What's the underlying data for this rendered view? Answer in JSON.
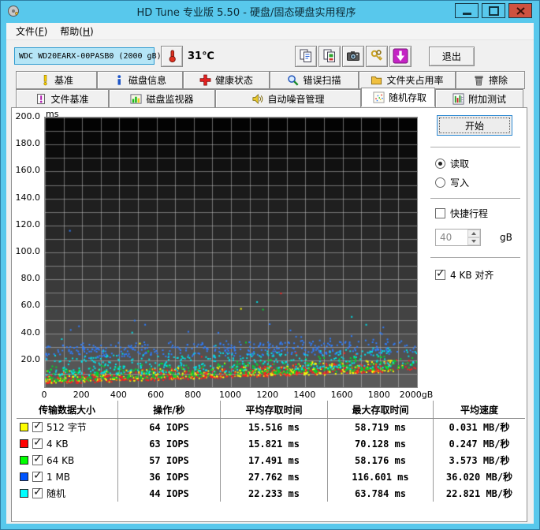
{
  "window": {
    "title": "HD Tune 专业版 5.50 - 硬盘/固态硬盘实用程序"
  },
  "menu": {
    "items": [
      {
        "pre": "文件(",
        "key": "F",
        "post": ")"
      },
      {
        "pre": "帮助(",
        "key": "H",
        "post": ")"
      }
    ]
  },
  "toolbar": {
    "drive_select": {
      "value": "WDC WD20EARX-00PASB0 (2000 gB)"
    },
    "temperature": "31℃",
    "icons": [
      "thermometer-icon",
      "copy-report-icon",
      "copy-image-icon",
      "camera-icon",
      "keys-icon",
      "update-icon"
    ],
    "exit_label": "退出"
  },
  "tabs": {
    "active": "随机存取",
    "row1": [
      {
        "label": "基准",
        "icon": "benchmark-icon"
      },
      {
        "label": "磁盘信息",
        "icon": "disk-info-icon"
      },
      {
        "label": "健康状态",
        "icon": "health-icon"
      },
      {
        "label": "错误扫描",
        "icon": "error-scan-icon"
      },
      {
        "label": "文件夹占用率",
        "icon": "folder-usage-icon"
      },
      {
        "label": "擦除",
        "icon": "erase-icon"
      }
    ],
    "row2": [
      {
        "label": "文件基准",
        "icon": "file-benchmark-icon"
      },
      {
        "label": "磁盘监视器",
        "icon": "disk-monitor-icon"
      },
      {
        "label": "自动噪音管理",
        "icon": "aam-icon"
      },
      {
        "label": "随机存取",
        "icon": "random-access-icon"
      },
      {
        "label": "附加测试",
        "icon": "extra-tests-icon"
      }
    ]
  },
  "controls": {
    "start_label": "开始",
    "read_label": "读取",
    "write_label": "写入",
    "read_selected": true,
    "write_selected": false,
    "short_stroke_label": "快捷行程",
    "short_stroke_checked": false,
    "short_stroke_value": "40",
    "short_stroke_unit": "gB",
    "align_label": "4 KB 对齐",
    "align_checked": true
  },
  "chart_data": {
    "type": "scatter",
    "title": "随机存取测试 (random access: access time vs disk position)",
    "ylabel_unit": "ms",
    "xlabel_unit": "gB",
    "xlim": [
      0,
      2000
    ],
    "ylim": [
      0,
      200
    ],
    "xticks": [
      0,
      200,
      400,
      600,
      800,
      1000,
      1200,
      1400,
      1600,
      1800,
      2000
    ],
    "xtick_last_label": "2000gB",
    "yticks": [
      20,
      40,
      60,
      80,
      100,
      120,
      140,
      160,
      180,
      200
    ],
    "x_grid_step": 100,
    "y_grid_step": 10,
    "grid_color": "rgba(200,200,200,0.5)",
    "background_gradient": [
      "#030303",
      "#5a5a5a"
    ],
    "series": [
      {
        "name": "512 字节",
        "color": "#ffff00",
        "approx_points": 420,
        "min_ms_at_0": 4.0,
        "min_ms_at_2000": 13.0,
        "band_ms": 8,
        "dist_pow": 2.2,
        "outlier_rate": 0.012,
        "outlier_max_ms": 46,
        "observed_avg_ms": 15.516,
        "observed_max_ms": 58.719
      },
      {
        "name": "4 KB",
        "color": "#ff2020",
        "approx_points": 420,
        "min_ms_at_0": 3.2,
        "min_ms_at_2000": 13.5,
        "band_ms": 8,
        "dist_pow": 2.2,
        "outlier_rate": 0.008,
        "outlier_max_ms": 52,
        "observed_avg_ms": 15.821,
        "observed_max_ms": 70.128
      },
      {
        "name": "64 KB",
        "color": "#00d830",
        "approx_points": 400,
        "min_ms_at_0": 5.0,
        "min_ms_at_2000": 15.0,
        "band_ms": 10,
        "dist_pow": 2.0,
        "outlier_rate": 0.015,
        "outlier_max_ms": 56,
        "observed_avg_ms": 17.491,
        "observed_max_ms": 58.176
      },
      {
        "name": "1 MB",
        "color": "#2e7dff",
        "approx_points": 380,
        "min_ms_at_0": 22.0,
        "min_ms_at_2000": 26.0,
        "band_ms": 10,
        "dist_pow": 1.0,
        "outlier_rate": 0.05,
        "outlier_max_ms": 58,
        "observed_avg_ms": 27.762,
        "observed_max_ms": 116.601,
        "outlier_point": {
          "x_gb": 130,
          "y_ms": 116.6
        }
      },
      {
        "name": "随机",
        "color": "#00e0e8",
        "approx_points": 400,
        "min_ms_at_0": 9.0,
        "min_ms_at_2000": 16.0,
        "band_ms": 14,
        "dist_pow": 1.5,
        "outlier_rate": 0.02,
        "outlier_max_ms": 55,
        "observed_avg_ms": 22.233,
        "observed_max_ms": 63.784
      }
    ]
  },
  "results_table": {
    "headers": [
      "传输数据大小",
      "操作/秒",
      "平均存取时间",
      "最大存取时间",
      "平均速度"
    ],
    "rows": [
      {
        "color": "#ffff00",
        "checked": true,
        "label": "512 字节",
        "ops": "64 IOPS",
        "avg": "15.516 ms",
        "max": "58.719 ms",
        "speed": "0.031 MB/秒"
      },
      {
        "color": "#ff0000",
        "checked": true,
        "label": "4 KB",
        "ops": "63 IOPS",
        "avg": "15.821 ms",
        "max": "70.128 ms",
        "speed": "0.247 MB/秒"
      },
      {
        "color": "#00ff00",
        "checked": true,
        "label": "64 KB",
        "ops": "57 IOPS",
        "avg": "17.491 ms",
        "max": "58.176 ms",
        "speed": "3.573 MB/秒"
      },
      {
        "color": "#0055ff",
        "checked": true,
        "label": "1 MB",
        "ops": "36 IOPS",
        "avg": "27.762 ms",
        "max": "116.601 ms",
        "speed": "36.020 MB/秒"
      },
      {
        "color": "#00ffff",
        "checked": true,
        "label": "随机",
        "ops": "44 IOPS",
        "avg": "22.233 ms",
        "max": "63.784 ms",
        "speed": "22.821 MB/秒"
      }
    ]
  }
}
